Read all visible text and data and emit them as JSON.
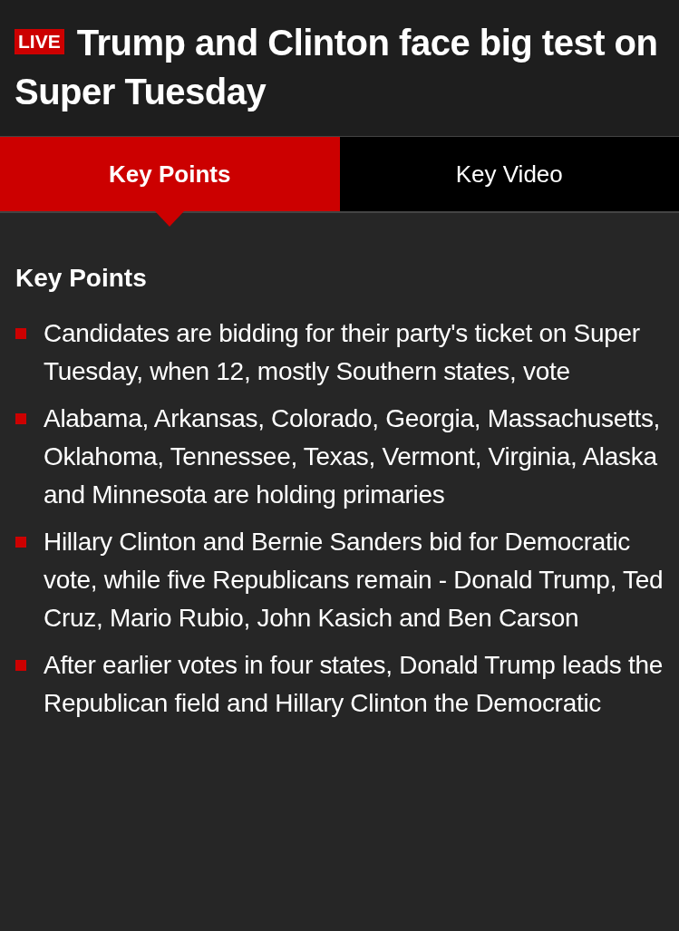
{
  "header": {
    "badge": "LIVE",
    "title": "Trump and Clinton face big test on Super Tuesday"
  },
  "tabs": [
    {
      "label": "Key Points",
      "selected": true
    },
    {
      "label": "Key Video",
      "selected": false
    }
  ],
  "section": {
    "heading": "Key Points",
    "points": [
      "Candidates are bidding for their party's ticket on Super Tuesday, when 12, mostly Southern states, vote",
      "Alabama, Arkansas, Colorado, Georgia, Massachusetts, Oklahoma, Tennessee, Texas, Vermont, Virginia, Alaska and Minnesota are holding primaries",
      "Hillary Clinton and Bernie Sanders bid for Democratic vote, while five Republicans remain - Donald Trump, Ted Cruz, Mario Rubio, John Kasich and Ben Carson",
      "After earlier votes in four states, Donald Trump leads the Republican field and Hillary Clinton the Democratic"
    ]
  }
}
